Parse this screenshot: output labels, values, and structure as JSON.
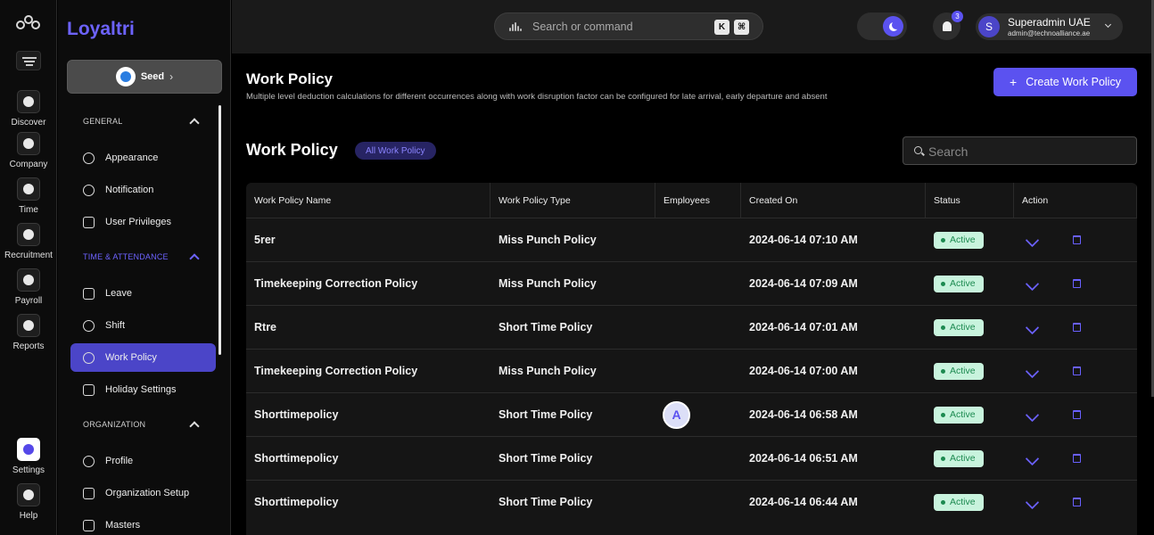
{
  "rail": {
    "items": [
      {
        "label": "Discover",
        "icon": "compass-icon"
      },
      {
        "label": "Company",
        "icon": "building-icon"
      },
      {
        "label": "Time",
        "icon": "clock-icon"
      },
      {
        "label": "Recruitment",
        "icon": "people-icon"
      },
      {
        "label": "Payroll",
        "icon": "dollar-icon"
      },
      {
        "label": "Reports",
        "icon": "report-icon"
      },
      {
        "label": "Settings",
        "icon": "gear-icon"
      },
      {
        "label": "Help",
        "icon": "question-icon"
      }
    ]
  },
  "panel": {
    "brand": "Loyaltri",
    "org": {
      "label": "Seed"
    },
    "sections": [
      {
        "title": "GENERAL",
        "items": [
          "Appearance",
          "Notification",
          "User Privileges"
        ]
      },
      {
        "title": "TIME & ATTENDANCE",
        "items": [
          "Leave",
          "Shift",
          "Work Policy",
          "Holiday Settings"
        ]
      },
      {
        "title": "ORGANIZATION",
        "items": [
          "Profile",
          "Organization Setup",
          "Masters"
        ]
      }
    ],
    "active_item": "Work Policy"
  },
  "topbar": {
    "search_placeholder": "Search or command",
    "kbd1": "K",
    "kbd2": "⌘",
    "notification_count": "3",
    "user": {
      "initial": "S",
      "name": "Superadmin UAE",
      "email": "admin@technoalliance.ae"
    }
  },
  "page": {
    "title": "Work Policy",
    "description": "Multiple level deduction calculations for different occurrences along with work disruption factor can be configured for late arrival, early departure and absent",
    "create_button": "Create Work Policy",
    "section_title": "Work Policy",
    "filter_chip": "All Work Policy",
    "search_placeholder": "Search"
  },
  "table": {
    "columns": [
      "Work Policy Name",
      "Work Policy Type",
      "Employees",
      "Created On",
      "Status",
      "Action"
    ],
    "rows": [
      {
        "name": "5rer",
        "type": "Miss Punch Policy",
        "employee": "",
        "created": "2024-06-14 07:10 AM",
        "status": "Active"
      },
      {
        "name": "Timekeeping Correction Policy",
        "type": "Miss Punch Policy",
        "employee": "",
        "created": "2024-06-14 07:09 AM",
        "status": "Active"
      },
      {
        "name": "Rtre",
        "type": "Short Time Policy",
        "employee": "",
        "created": "2024-06-14 07:01 AM",
        "status": "Active"
      },
      {
        "name": "Timekeeping Correction Policy",
        "type": "Miss Punch Policy",
        "employee": "",
        "created": "2024-06-14 07:00 AM",
        "status": "Active"
      },
      {
        "name": "Shorttimepolicy",
        "type": "Short Time Policy",
        "employee": "A",
        "created": "2024-06-14 06:58 AM",
        "status": "Active"
      },
      {
        "name": "Shorttimepolicy",
        "type": "Short Time Policy",
        "employee": "",
        "created": "2024-06-14 06:51 AM",
        "status": "Active"
      },
      {
        "name": "Shorttimepolicy",
        "type": "Short Time Policy",
        "employee": "",
        "created": "2024-06-14 06:44 AM",
        "status": "Active"
      }
    ]
  },
  "colors": {
    "accent": "#5b52f0",
    "active_status_bg": "#c8f3dd",
    "active_status_text": "#1c8a50"
  }
}
